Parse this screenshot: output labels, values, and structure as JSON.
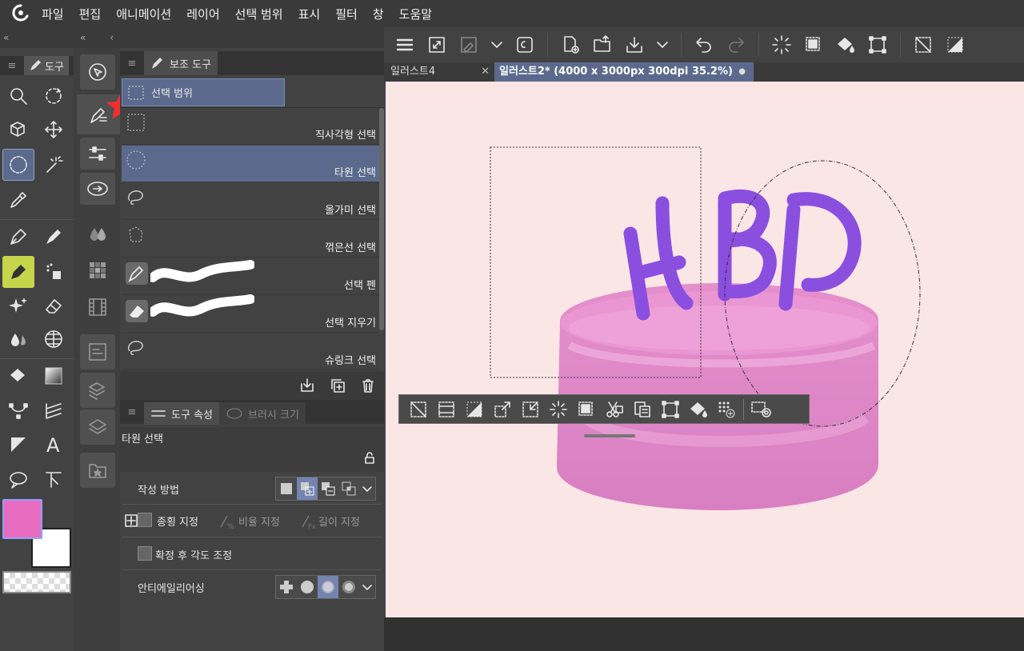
{
  "menu": {
    "items": [
      "파일",
      "편집",
      "애니메이션",
      "레이어",
      "선택 범위",
      "표시",
      "필터",
      "창",
      "도움말"
    ]
  },
  "tool_panel": {
    "tab_label": "도구"
  },
  "sub_tool_panel": {
    "tab_label": "보조 도구",
    "group_label": "선택 범위",
    "items": [
      {
        "label": "직사각형 선택",
        "icon": "rect-select-icon"
      },
      {
        "label": "타원 선택",
        "icon": "ellipse-select-icon",
        "selected": true
      },
      {
        "label": "올가미 선택",
        "icon": "lasso-icon"
      },
      {
        "label": "꺾은선 선택",
        "icon": "polyline-select-icon"
      },
      {
        "label": "선택 펜",
        "icon": "selection-pen-icon"
      },
      {
        "label": "선택 지우기",
        "icon": "selection-eraser-icon"
      },
      {
        "label": "슈링크 선택",
        "icon": "shrink-select-icon"
      }
    ]
  },
  "tool_property": {
    "tab_label": "도구 속성",
    "tab2_label": "브러시 크기",
    "tool_name": "타원 선택",
    "creation_method_label": "작성 방법",
    "aspect_label": "종횡 지정",
    "ratio_label": "비율 지정",
    "length_label": "길이 지정",
    "adjust_angle_label": "확정 후 각도 조정",
    "antialiasing_label": "안티에일리어싱"
  },
  "canvas_tabs": [
    {
      "label": "일러스트4"
    },
    {
      "label": "일러스트2* (4000 x 3000px 300dpi 35.2%)"
    }
  ],
  "canvas": {
    "text": "HBD",
    "background": "#fbe6e6"
  },
  "colors": {
    "main_color": "#e86cc0",
    "sub_color": "#ffffff",
    "selection_accent": "#5b6a8c"
  }
}
